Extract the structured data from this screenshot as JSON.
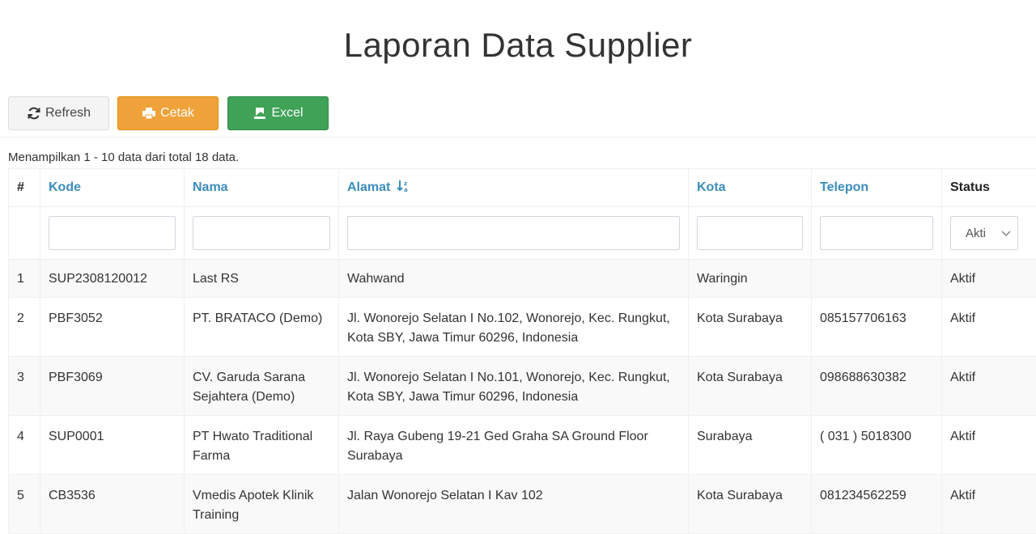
{
  "page": {
    "title": "Laporan Data Supplier"
  },
  "toolbar": {
    "refresh_label": "Refresh",
    "print_label": "Cetak",
    "excel_label": "Excel"
  },
  "summary": "Menampilkan 1 - 10 data dari total 18 data.",
  "table": {
    "headers": {
      "index": "#",
      "kode": "Kode",
      "nama": "Nama",
      "alamat": "Alamat",
      "kota": "Kota",
      "telepon": "Telepon",
      "status": "Status"
    },
    "sorted_column": "alamat",
    "status_filter": "Akti",
    "rows": [
      {
        "no": "1",
        "kode": "SUP2308120012",
        "nama": "Last RS",
        "alamat": "Wahwand",
        "kota": "Waringin",
        "telepon": "",
        "status": "Aktif"
      },
      {
        "no": "2",
        "kode": "PBF3052",
        "nama": "PT. BRATACO (Demo)",
        "alamat": "Jl. Wonorejo Selatan I No.102, Wonorejo, Kec. Rungkut, Kota SBY, Jawa Timur 60296, Indonesia",
        "kota": "Kota Surabaya",
        "telepon": "085157706163",
        "status": "Aktif"
      },
      {
        "no": "3",
        "kode": "PBF3069",
        "nama": "CV. Garuda Sarana Sejahtera (Demo)",
        "alamat": "Jl. Wonorejo Selatan I No.101, Wonorejo, Kec. Rungkut, Kota SBY, Jawa Timur 60296, Indonesia",
        "kota": "Kota Surabaya",
        "telepon": "098688630382",
        "status": "Aktif"
      },
      {
        "no": "4",
        "kode": "SUP0001",
        "nama": "PT Hwato Traditional Farma",
        "alamat": "Jl. Raya Gubeng 19-21 Ged Graha SA Ground Floor Surabaya",
        "kota": "Surabaya",
        "telepon": "( 031 ) 5018300",
        "status": "Aktif"
      },
      {
        "no": "5",
        "kode": "CB3536",
        "nama": "Vmedis Apotek Klinik Training",
        "alamat": "Jalan Wonorejo Selatan I Kav 102",
        "kota": "Kota Surabaya",
        "telepon": "081234562259",
        "status": "Aktif"
      }
    ]
  },
  "colors": {
    "link": "#3c8dbc",
    "warning": "#f0a33a",
    "success": "#3fa256"
  }
}
